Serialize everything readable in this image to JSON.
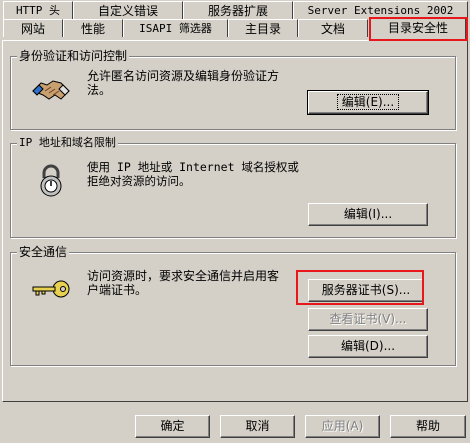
{
  "tabs_back": [
    {
      "label": "HTTP 头"
    },
    {
      "label": "自定义错误"
    },
    {
      "label": "服务器扩展"
    },
    {
      "label": "Server Extensions 2002"
    }
  ],
  "tabs_front": [
    {
      "label": "网站"
    },
    {
      "label": "性能"
    },
    {
      "label": "ISAPI 筛选器"
    },
    {
      "label": "主目录"
    },
    {
      "label": "文档"
    },
    {
      "label": "目录安全性"
    }
  ],
  "groups": {
    "auth": {
      "title": "身份验证和访问控制",
      "desc": "允许匿名访问资源及编辑身份验证方\n法。",
      "edit_label": "编辑(E)..."
    },
    "ip": {
      "title": "IP 地址和域名限制",
      "desc": "使用 IP 地址或 Internet 域名授权或\n拒绝对资源的访问。",
      "edit_label": "编辑(I)..."
    },
    "secure": {
      "title": "安全通信",
      "desc": "访问资源时，要求安全通信并启用客\n户端证书。",
      "cert_label": "服务器证书(S)...",
      "view_label": "查看证书(V)...",
      "edit_label": "编辑(D)..."
    }
  },
  "footer": {
    "ok": "确定",
    "cancel": "取消",
    "apply": "应用(A)",
    "help": "帮助"
  },
  "icons": [
    "handshake-icon",
    "lock-icon",
    "key-icon"
  ],
  "highlight_color": "#e8171c"
}
